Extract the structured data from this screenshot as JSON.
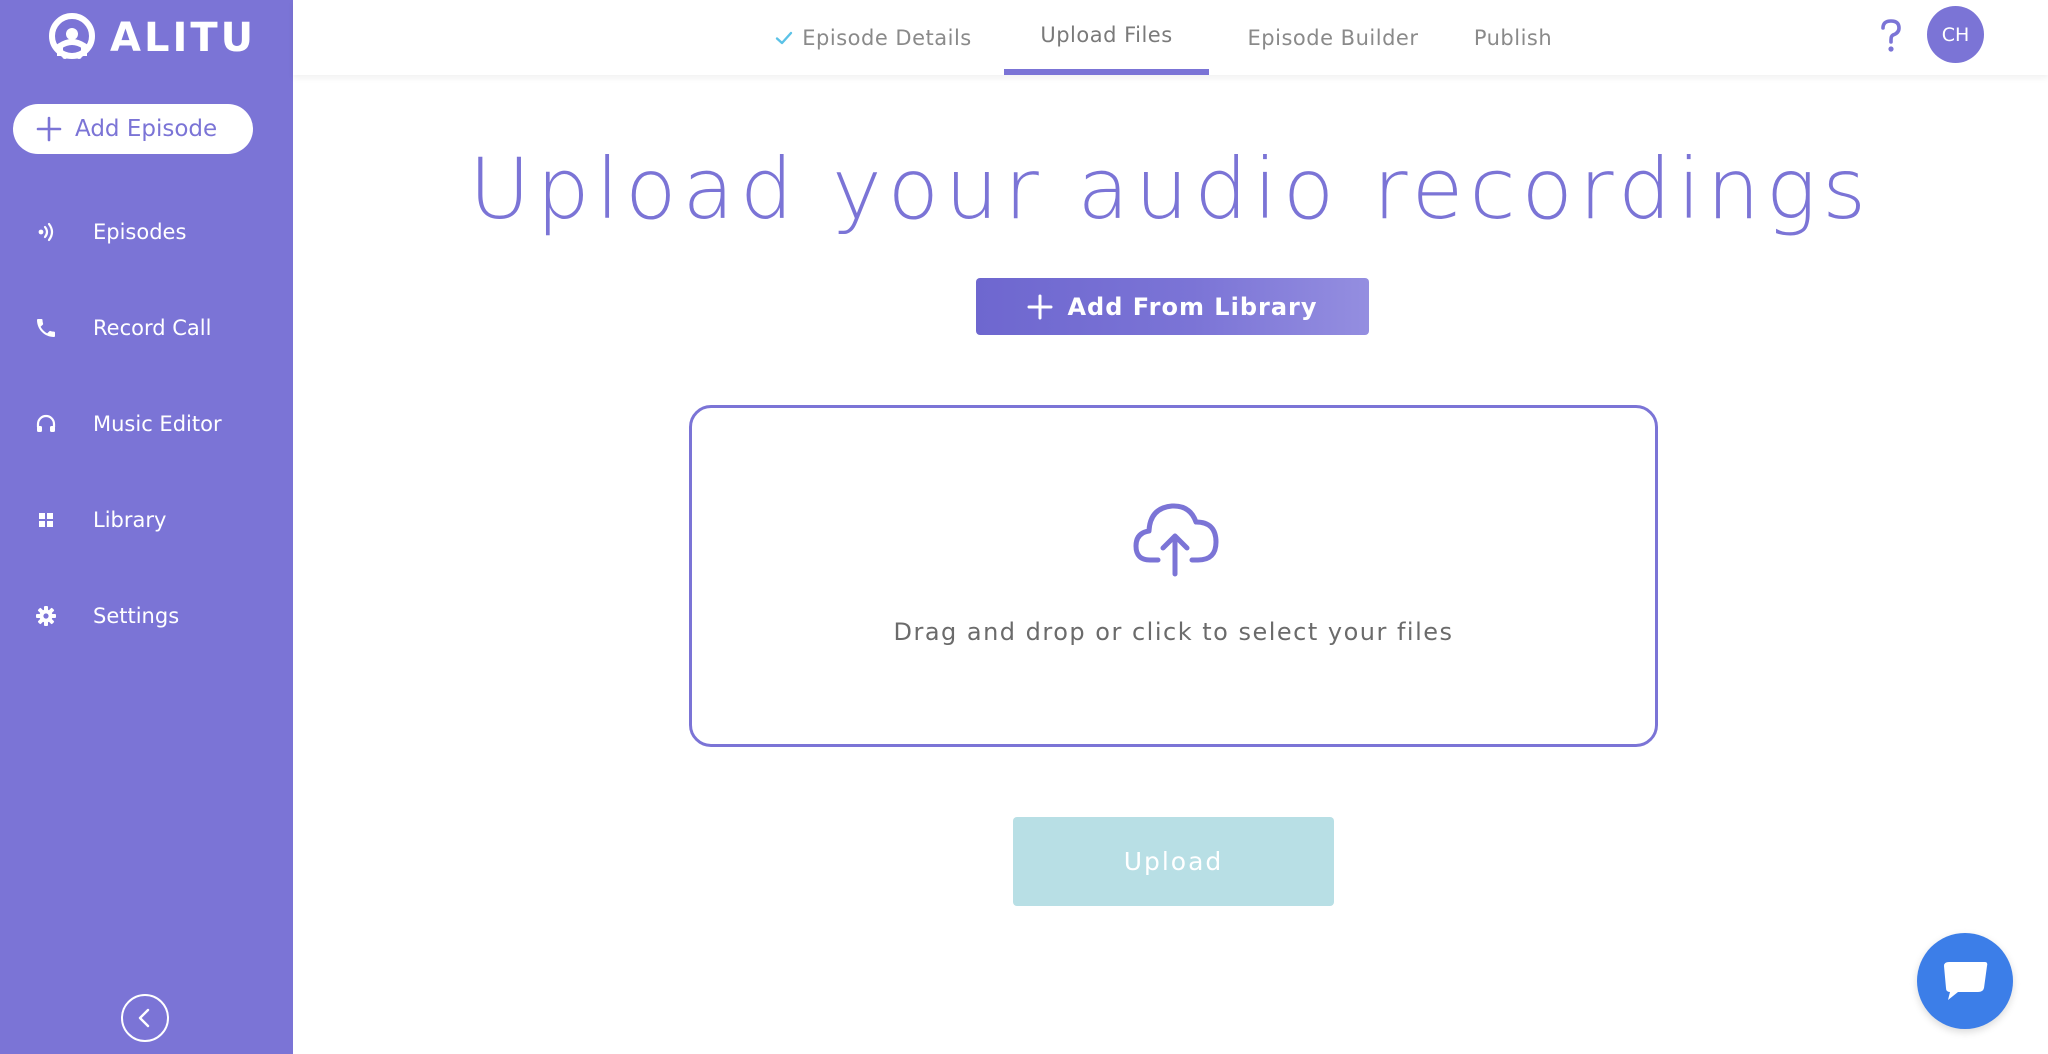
{
  "app": {
    "logo_text": "ALITU"
  },
  "sidebar": {
    "add_episode_label": "Add Episode",
    "items": [
      {
        "label": "Episodes",
        "icon": "episodes-icon"
      },
      {
        "label": "Record Call",
        "icon": "phone-icon"
      },
      {
        "label": "Music Editor",
        "icon": "headphones-icon"
      },
      {
        "label": "Library",
        "icon": "grid-icon"
      },
      {
        "label": "Settings",
        "icon": "gear-icon"
      }
    ]
  },
  "header": {
    "tabs": [
      {
        "label": "Episode Details",
        "completed": true
      },
      {
        "label": "Upload Files",
        "active": true
      },
      {
        "label": "Episode Builder"
      },
      {
        "label": "Publish"
      }
    ],
    "avatar_initials": "CH"
  },
  "main": {
    "title": "Upload your audio recordings",
    "add_library_label": "Add From Library",
    "dropzone_text": "Drag and drop or click to select your files",
    "upload_label": "Upload"
  },
  "colors": {
    "brand": "#7b74d6",
    "check": "#5bc2e7",
    "upload_disabled": "#b8dfe5",
    "chat": "#3c7ee8"
  }
}
